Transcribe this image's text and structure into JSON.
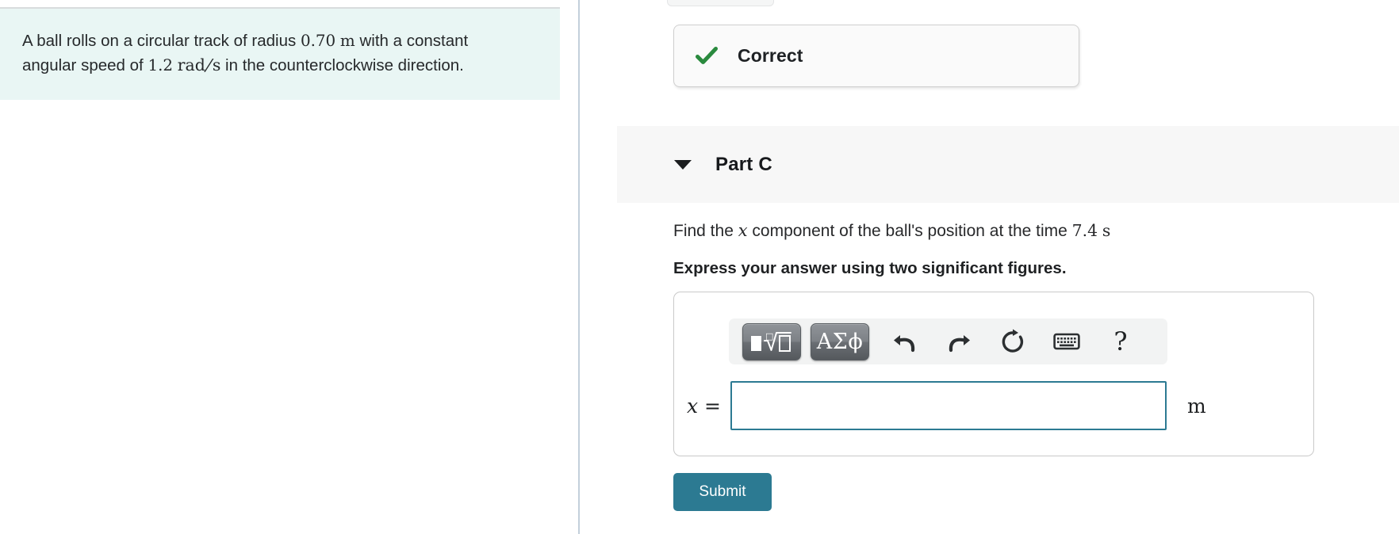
{
  "left_panel": {
    "problem_statement": {
      "line1_before_radius": "A ball rolls on a circular track of radius ",
      "radius_value": "0.70",
      "radius_unit": "m",
      "line1_after_radius": " with a constant",
      "line2_before_speed": "angular speed of ",
      "speed_value": "1.2",
      "speed_unit_numerator": "rad",
      "speed_unit_slash": "/",
      "speed_unit_denominator": "s",
      "line2_after_speed": " in the counterclockwise direction."
    }
  },
  "right_panel": {
    "feedback": {
      "icon": "check-mark-icon",
      "label": "Correct",
      "accent_color": "#2a8a3e"
    },
    "part": {
      "toggle_icon": "caret-down-icon",
      "title": "Part C",
      "header_bg": "#f7f7f7"
    },
    "question": {
      "prompt_before_var": "Find the ",
      "prompt_var": "x",
      "prompt_after_var": " component of the ball's position at the time ",
      "time_value": "7.4",
      "time_unit": "s",
      "instruction": "Express your answer using two significant figures."
    },
    "answer_widget": {
      "toolbar": {
        "template_button": {
          "name": "math-template-button",
          "box_glyph": "■",
          "radical_glyph": "√",
          "empty_box_glyph": "□"
        },
        "greek_button": {
          "name": "greek-symbols-button",
          "label": "ΑΣϕ"
        },
        "undo_button": {
          "name": "undo-icon",
          "tooltip": "Undo"
        },
        "redo_button": {
          "name": "redo-icon",
          "tooltip": "Redo"
        },
        "reset_button": {
          "name": "reset-icon",
          "tooltip": "Reset"
        },
        "keyboard_button": {
          "name": "keyboard-icon",
          "tooltip": "Keyboard shortcuts"
        },
        "help_button": {
          "name": "help-icon",
          "label": "?"
        }
      },
      "input": {
        "variable_label": "x",
        "equals_sign": "=",
        "value": "",
        "placeholder": "",
        "unit": "m",
        "border_color": "#2c7a92"
      }
    },
    "submit": {
      "label": "Submit",
      "color": "#2c7a92"
    }
  }
}
